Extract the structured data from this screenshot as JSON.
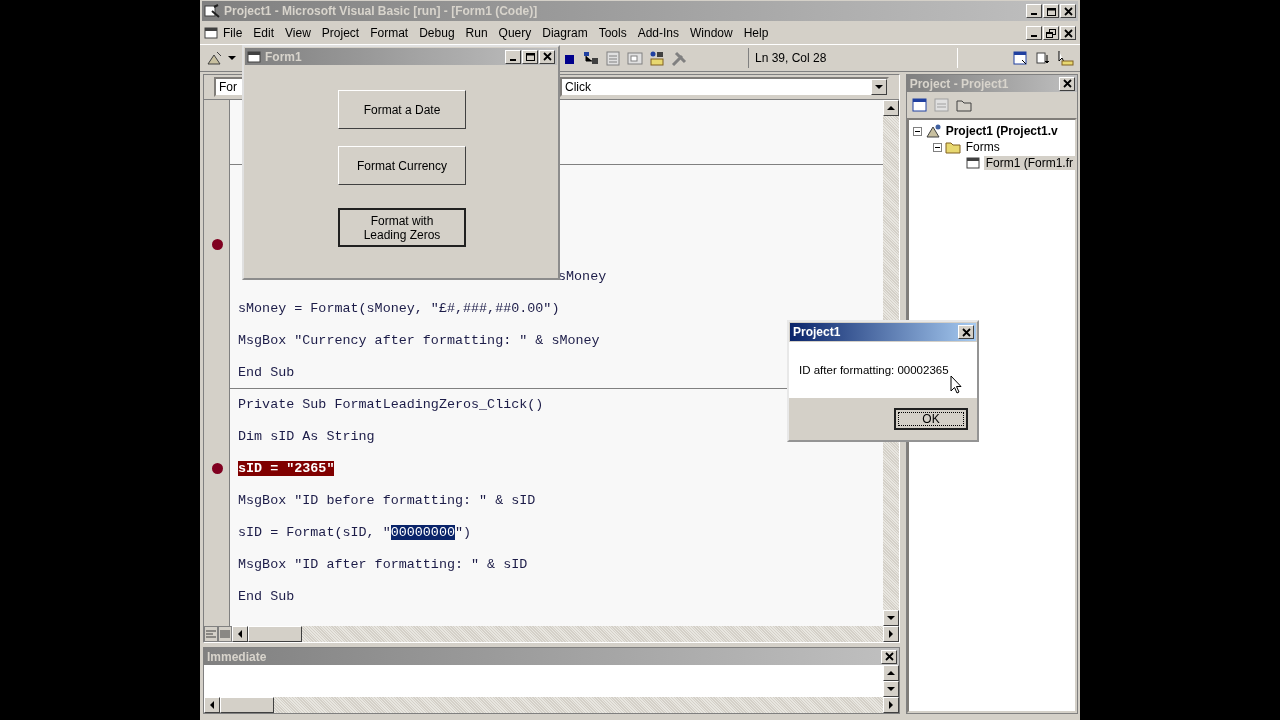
{
  "window": {
    "title": "Project1 - Microsoft Visual Basic [run] - [Form1 (Code)]"
  },
  "menu": [
    "File",
    "Edit",
    "View",
    "Project",
    "Format",
    "Debug",
    "Run",
    "Query",
    "Diagram",
    "Tools",
    "Add-Ins",
    "Window",
    "Help"
  ],
  "toolbar": {
    "position": "Ln 39, Col 28"
  },
  "code": {
    "object_combo": "For",
    "procedure_combo": "Click",
    "lines": [
      {
        "kind": "covered",
        "breakpoint": false,
        "separator_before": false
      },
      {
        "kind": "covered",
        "breakpoint": false,
        "separator_before": false
      },
      {
        "kind": "covered",
        "breakpoint": false,
        "separator_before": true
      },
      {
        "kind": "covered",
        "breakpoint": false,
        "separator_before": false
      },
      {
        "kind": "covered",
        "breakpoint": true,
        "separator_before": false
      },
      {
        "kind": "tail",
        "text": "sMoney",
        "breakpoint": false,
        "separator_before": false
      },
      {
        "kind": "code",
        "text": "sMoney = Format(sMoney, \"£#,###,##0.00\")",
        "breakpoint": false,
        "separator_before": false
      },
      {
        "kind": "code",
        "text": "MsgBox \"Currency after formatting: \" & sMoney",
        "breakpoint": false,
        "separator_before": false
      },
      {
        "kind": "code",
        "text": "End Sub",
        "breakpoint": false,
        "separator_before": false
      },
      {
        "kind": "code",
        "text": "Private Sub FormatLeadingZeros_Click()",
        "breakpoint": false,
        "separator_before": true
      },
      {
        "kind": "code",
        "text": "Dim sID As String",
        "breakpoint": false,
        "separator_before": false
      },
      {
        "kind": "code",
        "text": "sID = \"2365\"",
        "breakpoint": true,
        "separator_before": false
      },
      {
        "kind": "code",
        "text": "MsgBox \"ID before formatting: \" & sID",
        "breakpoint": false,
        "separator_before": false
      },
      {
        "kind": "code",
        "segments": [
          {
            "text": "sID = Format(sID, \"",
            "selected": false
          },
          {
            "text": "00000000",
            "selected": true
          },
          {
            "text": "\")",
            "selected": false
          }
        ],
        "breakpoint": false,
        "separator_before": false
      },
      {
        "kind": "code",
        "text": "MsgBox \"ID after formatting: \" & sID",
        "breakpoint": false,
        "separator_before": false
      },
      {
        "kind": "code",
        "text": "End Sub",
        "breakpoint": false,
        "separator_before": false
      }
    ]
  },
  "immediate": {
    "title": "Immediate"
  },
  "project": {
    "title": "Project - Project1",
    "tree": [
      {
        "label": "Project1 (Project1.v",
        "kind": "project",
        "expanded": true,
        "selected": false,
        "children": [
          {
            "label": "Forms",
            "kind": "folder",
            "expanded": true,
            "selected": false,
            "children": [
              {
                "label": "Form1 (Form1.fr",
                "kind": "form",
                "selected": true
              }
            ]
          }
        ]
      }
    ]
  },
  "form_window": {
    "title": "Form1",
    "buttons": [
      {
        "label": "Format a Date",
        "focused": false
      },
      {
        "label": "Format Currency",
        "focused": false
      },
      {
        "label": "Format with Leading Zeros",
        "focused": true
      }
    ]
  },
  "dialog": {
    "title": "Project1",
    "message": "ID after formatting: 00002365",
    "button": "OK"
  }
}
